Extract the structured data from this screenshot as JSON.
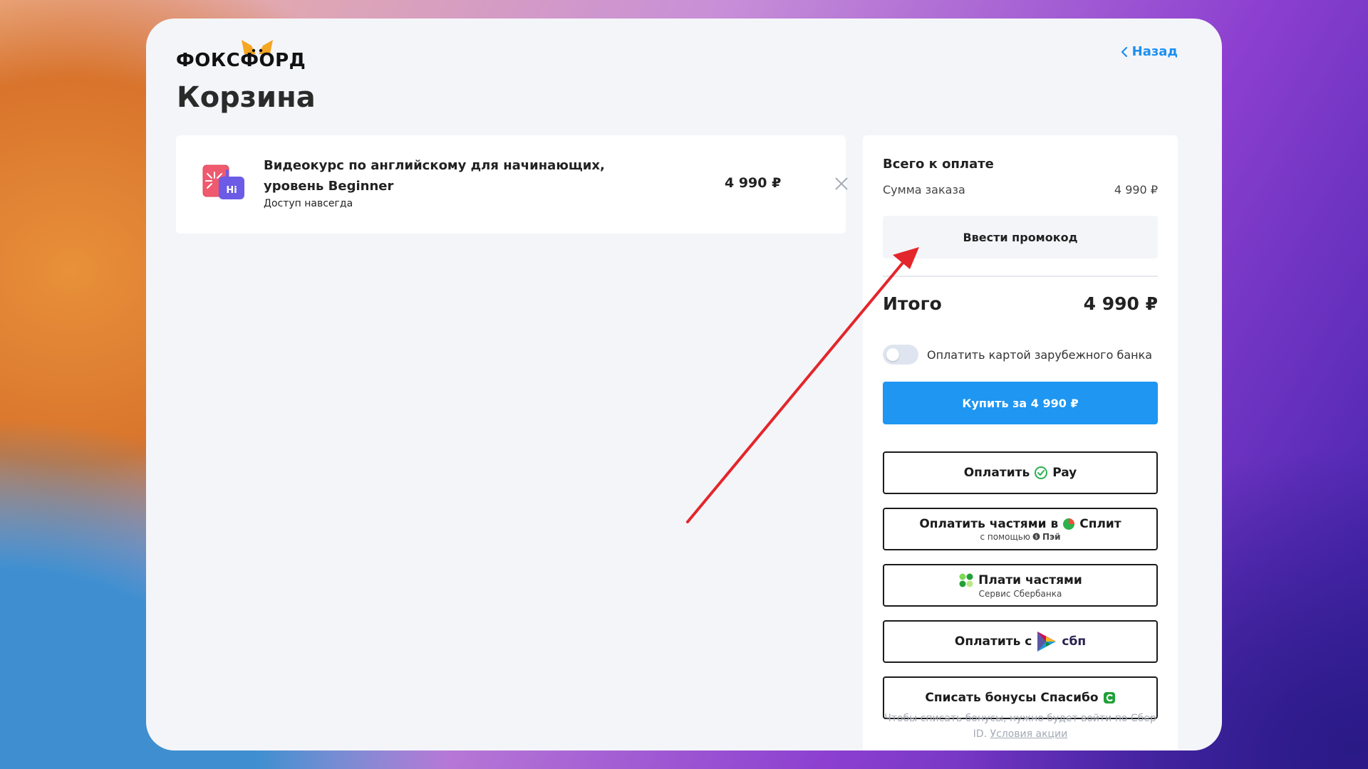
{
  "header": {
    "logo_text": "ФОКСФОРД",
    "back_label": "Назад"
  },
  "page": {
    "title": "Корзина"
  },
  "cart": {
    "items": [
      {
        "title": "Видеокурс по английскому для начинающих, уровень Beginner",
        "subtitle": "Доступ навсегда",
        "price": "4 990 ₽",
        "image_icon": "english-course-icon",
        "image_badge": "Hi"
      }
    ]
  },
  "summary": {
    "heading": "Всего к оплате",
    "order_sum_label": "Сумма заказа",
    "order_sum_value": "4 990 ₽",
    "promo_button": "Ввести промокод",
    "total_label": "Итого",
    "total_value": "4 990 ₽",
    "foreign_card_toggle_label": "Оплатить картой зарубежного банка",
    "foreign_card_toggle_on": false,
    "buy_button": "Купить за  4 990 ₽",
    "accent_color": "#1e96f2",
    "pay_options": [
      {
        "label": "Оплатить",
        "brand": "Pay",
        "icon": "yandex-pay-check-icon"
      },
      {
        "label": "Оплатить частями в",
        "brand": "Сплит",
        "sub_prefix": "с помощью",
        "sub_brand": "Пэй",
        "icon": "split-icon"
      },
      {
        "label": "Плати частями",
        "sub": "Сервис Сбербанка",
        "icon": "sber-dots-icon"
      },
      {
        "label": "Оплатить с",
        "brand": "сбп",
        "icon": "sbp-logo-icon"
      },
      {
        "label": "Списать бонусы Спасибо",
        "icon": "spasibo-icon"
      }
    ],
    "footnote_text": "Чтобы списать бонусы, нужно будет войти по Сбер ID.",
    "footnote_link": "Условия акции"
  },
  "annotation": {
    "color": "#e3262b",
    "icon": "red-arrow-annotation"
  }
}
